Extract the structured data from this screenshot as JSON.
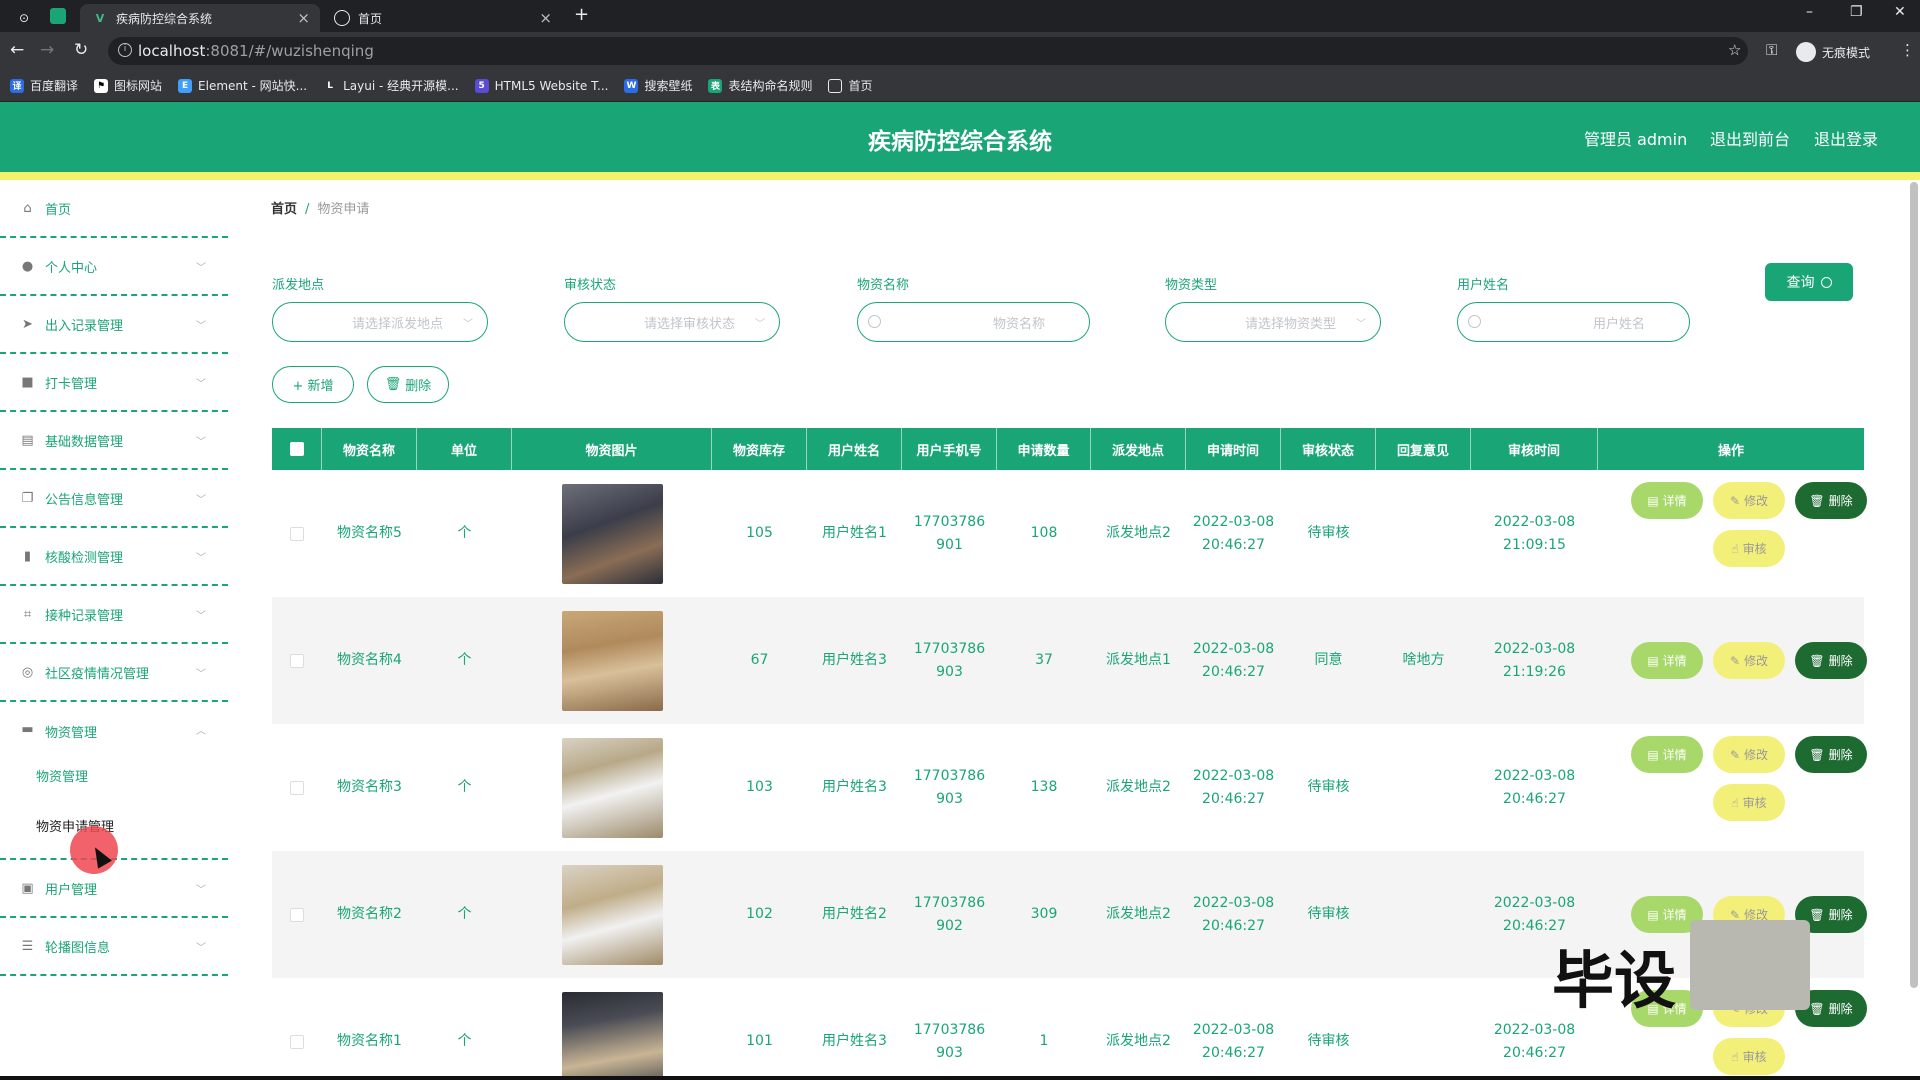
{
  "browser": {
    "tabs": [
      {
        "title": "疾病防控综合系统",
        "active": true
      },
      {
        "title": "首页",
        "active": false
      }
    ],
    "address": {
      "host": "localhost",
      "path": ":8081/#/wuzishenqing"
    },
    "profile_label": "无痕模式",
    "bookmarks": [
      "百度翻译",
      "图标网站",
      "Element - 网站快...",
      "Layui - 经典开源模...",
      "HTML5 Website T...",
      "搜索壁纸",
      "表结构命名规则",
      "首页"
    ]
  },
  "header": {
    "title": "疾病防控综合系统",
    "links": [
      "管理员 admin",
      "退出到前台",
      "退出登录"
    ],
    "brand_color": "#1aa577",
    "accent_color": "#f2f26b"
  },
  "sidebar": {
    "items": [
      {
        "label": "首页",
        "icon": "home-icon",
        "has_chevron": false
      },
      {
        "label": "个人中心",
        "icon": "user-icon",
        "has_chevron": true
      },
      {
        "label": "出入记录管理",
        "icon": "send-icon",
        "has_chevron": true
      },
      {
        "label": "打卡管理",
        "icon": "briefcase-icon",
        "has_chevron": true
      },
      {
        "label": "基础数据管理",
        "icon": "clipboard-icon",
        "has_chevron": true
      },
      {
        "label": "公告信息管理",
        "icon": "copy-icon",
        "has_chevron": true
      },
      {
        "label": "核酸检测管理",
        "icon": "bar-chart-icon",
        "has_chevron": true
      },
      {
        "label": "接种记录管理",
        "icon": "crop-icon",
        "has_chevron": true
      },
      {
        "label": "社区疫情情况管理",
        "icon": "compass-icon",
        "has_chevron": true
      },
      {
        "label": "物资管理",
        "icon": "box-icon",
        "has_chevron": true,
        "expanded": true
      },
      {
        "label": "用户管理",
        "icon": "trash-icon",
        "has_chevron": true
      },
      {
        "label": "轮播图信息",
        "icon": "sliders-icon",
        "has_chevron": true
      }
    ],
    "submenu": [
      "物资管理",
      "物资申请管理"
    ]
  },
  "breadcrumb": {
    "home": "首页",
    "sep": "/",
    "current": "物资申请"
  },
  "filters": [
    {
      "label": "派发地点",
      "placeholder": "请选择派发地点",
      "kind": "select"
    },
    {
      "label": "审核状态",
      "placeholder": "请选择审核状态",
      "kind": "select"
    },
    {
      "label": "物资名称",
      "placeholder": "物资名称",
      "kind": "search"
    },
    {
      "label": "物资类型",
      "placeholder": "请选择物资类型",
      "kind": "select"
    },
    {
      "label": "用户姓名",
      "placeholder": "用户姓名",
      "kind": "search"
    }
  ],
  "query_label": "查询",
  "actions": {
    "add": "+ 新增",
    "delete": "删除"
  },
  "table": {
    "headers": [
      "物资名称",
      "单位",
      "物资图片",
      "物资库存",
      "用户姓名",
      "用户手机号",
      "申请数量",
      "派发地点",
      "申请时间",
      "审核状态",
      "回复意见",
      "审核时间",
      "操作"
    ],
    "rows": [
      {
        "name": "物资名称5",
        "unit": "个",
        "stock": "105",
        "user": "用户姓名1",
        "phone": "17703786901",
        "qty": "108",
        "place": "派发地点2",
        "apply_time": "2022-03-08 20:46:27",
        "status": "待审核",
        "reply": "",
        "audit_time": "2022-03-08 21:09:15",
        "can_audit": true
      },
      {
        "name": "物资名称4",
        "unit": "个",
        "stock": "67",
        "user": "用户姓名3",
        "phone": "17703786903",
        "qty": "37",
        "place": "派发地点1",
        "apply_time": "2022-03-08 20:46:27",
        "status": "同意",
        "reply": "啥地方",
        "audit_time": "2022-03-08 21:19:26",
        "can_audit": false
      },
      {
        "name": "物资名称3",
        "unit": "个",
        "stock": "103",
        "user": "用户姓名3",
        "phone": "17703786903",
        "qty": "138",
        "place": "派发地点2",
        "apply_time": "2022-03-08 20:46:27",
        "status": "待审核",
        "reply": "",
        "audit_time": "2022-03-08 20:46:27",
        "can_audit": true
      },
      {
        "name": "物资名称2",
        "unit": "个",
        "stock": "102",
        "user": "用户姓名2",
        "phone": "17703786902",
        "qty": "309",
        "place": "派发地点2",
        "apply_time": "2022-03-08 20:46:27",
        "status": "待审核",
        "reply": "",
        "audit_time": "2022-03-08 20:46:27",
        "can_audit": false
      },
      {
        "name": "物资名称1",
        "unit": "个",
        "stock": "101",
        "user": "用户姓名3",
        "phone": "17703786903",
        "qty": "1",
        "place": "派发地点2",
        "apply_time": "2022-03-08 20:46:27",
        "status": "待审核",
        "reply": "",
        "audit_time": "2022-03-08 20:46:27",
        "can_audit": true
      }
    ],
    "op_labels": {
      "detail": "详情",
      "edit": "修改",
      "delete": "删除",
      "audit": "审核"
    }
  },
  "watermark": "毕设"
}
